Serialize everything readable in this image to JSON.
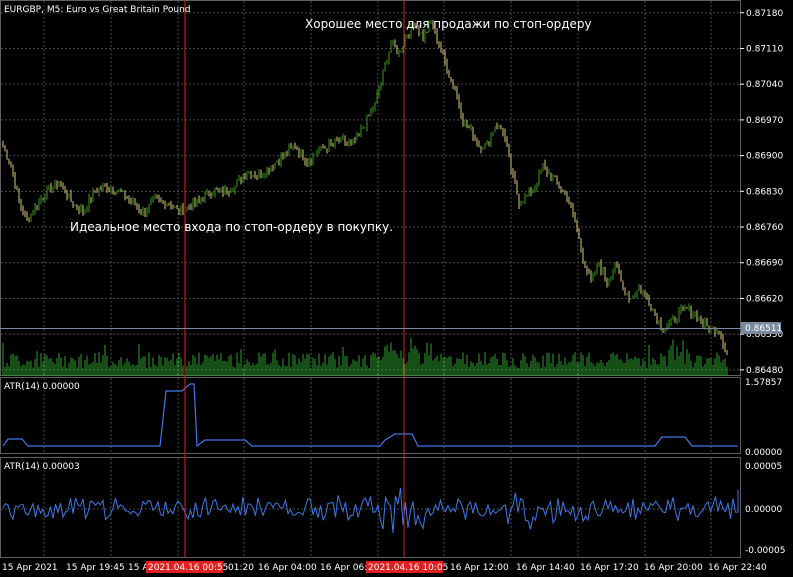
{
  "chart": {
    "symbol_label": "EURGBP, M5:  Euro vs Great Britain Pound",
    "annotation_sell": "Хорошее место для продажи по стоп-ордеру",
    "annotation_buy": "Идеальное место входа по стоп-ордеру в покупку.",
    "current_price": "0.86511",
    "colors": {
      "background": "#000000",
      "grid": "#4a4a4a",
      "bull": "#3a9a1a",
      "bear": "#d8c878",
      "volume": "#2ea02e",
      "atr": "#3c78e6",
      "marker": "#e02020",
      "price_line": "#7a8aa0",
      "time_highlight": "#e02020"
    }
  },
  "atr1": {
    "label": "ATR(14) 0.00000",
    "top_value": "1.57857",
    "bottom_value": "0.00000"
  },
  "atr2": {
    "label": "ATR(14) 0.00003",
    "top_value": "0.00005",
    "mid_value": "0.00000",
    "bottom_value": "-0.00005"
  },
  "x_axis": {
    "labels": [
      "15 Apr 2021",
      "15 Apr 19:45",
      "15 Apr",
      "01:20",
      "16 Apr 04:00",
      "16 Apr 06:",
      "16 Apr 12:00",
      "16 Apr 14:40",
      "16 Apr 17:20",
      "16 Apr 20:00",
      "16 Apr 22:40"
    ],
    "highlight_1": "2021.04.16 00:55",
    "highlight_2": "2021.04.16 10:05"
  },
  "chart_data": {
    "type": "candlestick",
    "y_ticks": [
      0.8718,
      0.8711,
      0.8704,
      0.8697,
      0.869,
      0.8683,
      0.8676,
      0.8669,
      0.8662,
      0.8655,
      0.8648
    ],
    "ylim": [
      0.86468,
      0.87205
    ],
    "anchors": [
      [
        0,
        0.8692
      ],
      [
        4,
        0.8688
      ],
      [
        8,
        0.8681
      ],
      [
        12,
        0.8677
      ],
      [
        16,
        0.868
      ],
      [
        22,
        0.8683
      ],
      [
        28,
        0.8685
      ],
      [
        34,
        0.8681
      ],
      [
        40,
        0.8679
      ],
      [
        46,
        0.8683
      ],
      [
        52,
        0.8684
      ],
      [
        58,
        0.8683
      ],
      [
        64,
        0.8681
      ],
      [
        70,
        0.8679
      ],
      [
        76,
        0.8681
      ],
      [
        82,
        0.8681
      ],
      [
        88,
        0.8679
      ],
      [
        93,
        0.868
      ],
      [
        98,
        0.8681
      ],
      [
        104,
        0.8683
      ],
      [
        110,
        0.8683
      ],
      [
        116,
        0.8684
      ],
      [
        122,
        0.8687
      ],
      [
        128,
        0.8686
      ],
      [
        134,
        0.8688
      ],
      [
        140,
        0.869
      ],
      [
        146,
        0.8692
      ],
      [
        152,
        0.8689
      ],
      [
        158,
        0.8691
      ],
      [
        164,
        0.8692
      ],
      [
        170,
        0.8693
      ],
      [
        174,
        0.8692
      ],
      [
        178,
        0.8694
      ],
      [
        182,
        0.8697
      ],
      [
        186,
        0.87
      ],
      [
        190,
        0.8706
      ],
      [
        194,
        0.8712
      ],
      [
        198,
        0.871
      ],
      [
        202,
        0.8714
      ],
      [
        206,
        0.8716
      ],
      [
        210,
        0.8713
      ],
      [
        214,
        0.8716
      ],
      [
        218,
        0.8712
      ],
      [
        222,
        0.8707
      ],
      [
        226,
        0.8703
      ],
      [
        230,
        0.8697
      ],
      [
        234,
        0.8695
      ],
      [
        238,
        0.8692
      ],
      [
        242,
        0.8692
      ],
      [
        246,
        0.8696
      ],
      [
        250,
        0.8695
      ],
      [
        254,
        0.8687
      ],
      [
        258,
        0.8681
      ],
      [
        262,
        0.8682
      ],
      [
        266,
        0.8684
      ],
      [
        270,
        0.8688
      ],
      [
        274,
        0.8686
      ],
      [
        278,
        0.8684
      ],
      [
        282,
        0.8682
      ],
      [
        286,
        0.8677
      ],
      [
        290,
        0.867
      ],
      [
        294,
        0.8665
      ],
      [
        298,
        0.8669
      ],
      [
        302,
        0.8665
      ],
      [
        306,
        0.8669
      ],
      [
        310,
        0.8664
      ],
      [
        314,
        0.8662
      ],
      [
        318,
        0.8664
      ],
      [
        322,
        0.8662
      ],
      [
        326,
        0.8659
      ],
      [
        330,
        0.8656
      ],
      [
        334,
        0.8657
      ],
      [
        338,
        0.8659
      ],
      [
        342,
        0.866
      ],
      [
        346,
        0.8659
      ],
      [
        350,
        0.8657
      ],
      [
        354,
        0.8656
      ],
      [
        358,
        0.8656
      ],
      [
        362,
        0.8651
      ]
    ],
    "marker_bars": [
      92,
      201
    ],
    "current_price": 0.86511
  }
}
